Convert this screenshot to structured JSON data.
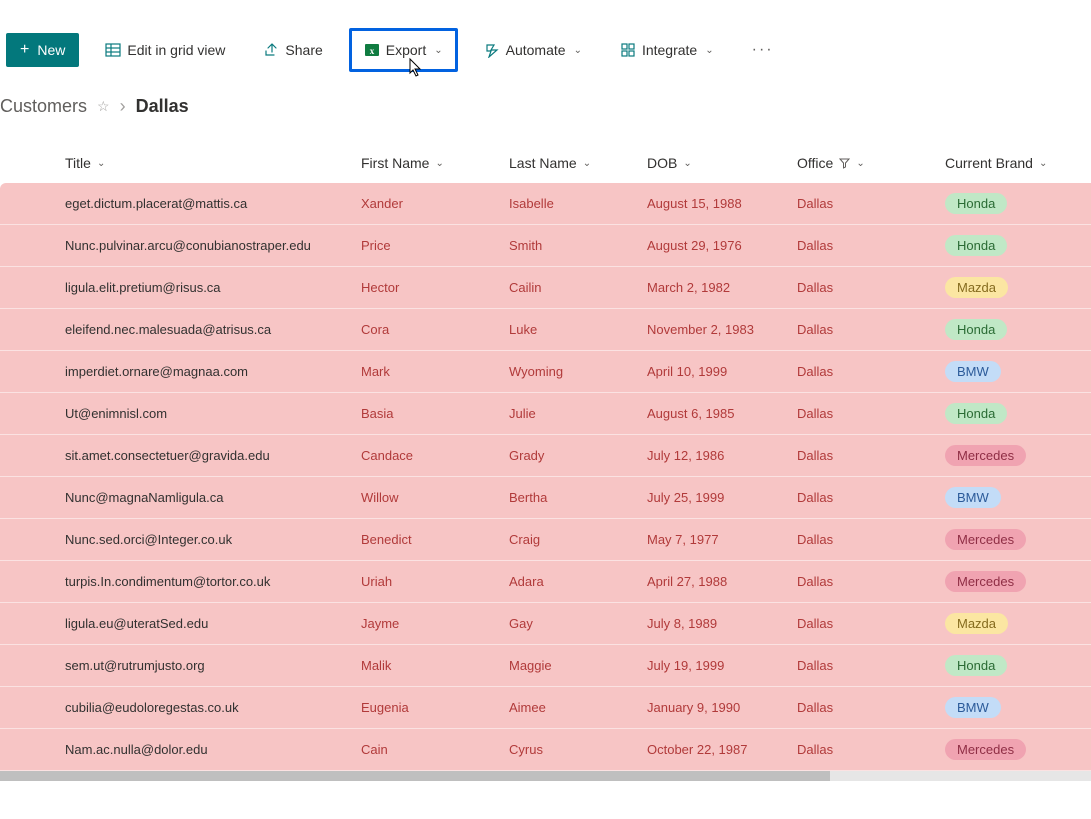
{
  "toolbar": {
    "new_label": "New",
    "edit_label": "Edit in grid view",
    "share_label": "Share",
    "export_label": "Export",
    "automate_label": "Automate",
    "integrate_label": "Integrate"
  },
  "breadcrumb": {
    "root": "Customers",
    "current": "Dallas"
  },
  "columns": {
    "title": "Title",
    "first": "First Name",
    "last": "Last Name",
    "dob": "DOB",
    "office": "Office",
    "brand": "Current Brand"
  },
  "rows": [
    {
      "title": "eget.dictum.placerat@mattis.ca",
      "first": "Xander",
      "last": "Isabelle",
      "dob": "August 15, 1988",
      "office": "Dallas",
      "brand": "Honda"
    },
    {
      "title": "Nunc.pulvinar.arcu@conubianostraper.edu",
      "first": "Price",
      "last": "Smith",
      "dob": "August 29, 1976",
      "office": "Dallas",
      "brand": "Honda"
    },
    {
      "title": "ligula.elit.pretium@risus.ca",
      "first": "Hector",
      "last": "Cailin",
      "dob": "March 2, 1982",
      "office": "Dallas",
      "brand": "Mazda"
    },
    {
      "title": "eleifend.nec.malesuada@atrisus.ca",
      "first": "Cora",
      "last": "Luke",
      "dob": "November 2, 1983",
      "office": "Dallas",
      "brand": "Honda"
    },
    {
      "title": "imperdiet.ornare@magnaa.com",
      "first": "Mark",
      "last": "Wyoming",
      "dob": "April 10, 1999",
      "office": "Dallas",
      "brand": "BMW"
    },
    {
      "title": "Ut@enimnisl.com",
      "first": "Basia",
      "last": "Julie",
      "dob": "August 6, 1985",
      "office": "Dallas",
      "brand": "Honda"
    },
    {
      "title": "sit.amet.consectetuer@gravida.edu",
      "first": "Candace",
      "last": "Grady",
      "dob": "July 12, 1986",
      "office": "Dallas",
      "brand": "Mercedes"
    },
    {
      "title": "Nunc@magnaNamligula.ca",
      "first": "Willow",
      "last": "Bertha",
      "dob": "July 25, 1999",
      "office": "Dallas",
      "brand": "BMW"
    },
    {
      "title": "Nunc.sed.orci@Integer.co.uk",
      "first": "Benedict",
      "last": "Craig",
      "dob": "May 7, 1977",
      "office": "Dallas",
      "brand": "Mercedes"
    },
    {
      "title": "turpis.In.condimentum@tortor.co.uk",
      "first": "Uriah",
      "last": "Adara",
      "dob": "April 27, 1988",
      "office": "Dallas",
      "brand": "Mercedes"
    },
    {
      "title": "ligula.eu@uteratSed.edu",
      "first": "Jayme",
      "last": "Gay",
      "dob": "July 8, 1989",
      "office": "Dallas",
      "brand": "Mazda"
    },
    {
      "title": "sem.ut@rutrumjusto.org",
      "first": "Malik",
      "last": "Maggie",
      "dob": "July 19, 1999",
      "office": "Dallas",
      "brand": "Honda"
    },
    {
      "title": "cubilia@eudoloregestas.co.uk",
      "first": "Eugenia",
      "last": "Aimee",
      "dob": "January 9, 1990",
      "office": "Dallas",
      "brand": "BMW"
    },
    {
      "title": "Nam.ac.nulla@dolor.edu",
      "first": "Cain",
      "last": "Cyrus",
      "dob": "October 22, 1987",
      "office": "Dallas",
      "brand": "Mercedes"
    }
  ]
}
